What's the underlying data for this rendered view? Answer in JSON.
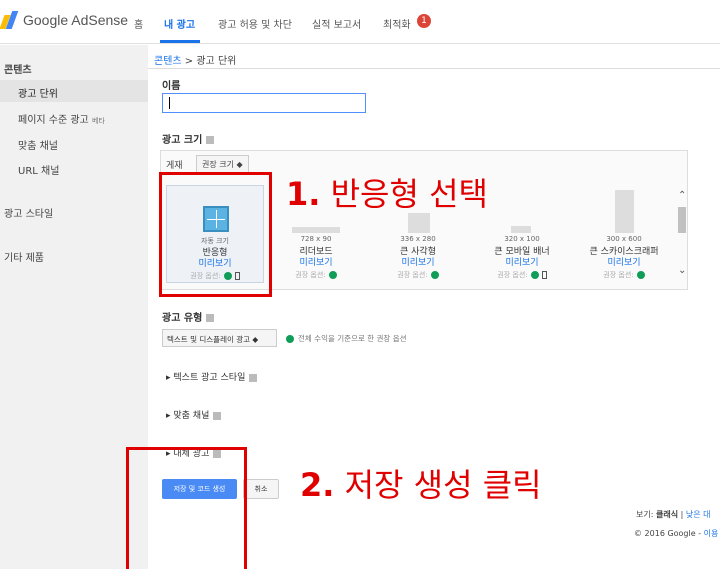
{
  "app": {
    "name": "Google AdSense"
  },
  "nav": [
    {
      "label": "홈"
    },
    {
      "label": "내 광고"
    },
    {
      "label": "광고 허용 및 차단"
    },
    {
      "label": "실적 보고서"
    },
    {
      "label": "최적화"
    }
  ],
  "nav_badge": "1",
  "sidebar": {
    "content_header": "콘텐츠",
    "items": [
      {
        "label": "광고 단위"
      },
      {
        "label": "페이지 수준 광고",
        "badge": "베타"
      },
      {
        "label": "맞춤 채널"
      },
      {
        "label": "URL 채널"
      }
    ],
    "ad_style": "광고 스타일",
    "other_products": "기타 제품"
  },
  "breadcrumb": {
    "link": "콘텐츠",
    "sep": " > ",
    "current": "광고 단위"
  },
  "form": {
    "name_label": "이름",
    "name_value": "",
    "size_label": "광고 크기",
    "filter_label": "게재",
    "filter_select": "권장 크기 ◆",
    "sizes": [
      {
        "dim": "자동 크기",
        "name": "반응형",
        "preview": "미리보기",
        "opt": "권장 옵션:"
      },
      {
        "dim": "728 x 90",
        "name": "리더보드",
        "preview": "미리보기",
        "opt": "권장 옵션:"
      },
      {
        "dim": "336 x 280",
        "name": "큰 사각형",
        "preview": "미리보기",
        "opt": "권장 옵션:"
      },
      {
        "dim": "320 x 100",
        "name": "큰 모바일 배너",
        "preview": "미리보기",
        "opt": "권장 옵션:"
      },
      {
        "dim": "300 x 600",
        "name": "큰 스카이스크래퍼",
        "preview": "미리보기",
        "opt": "권장 옵션:"
      }
    ],
    "type_label": "광고 유형",
    "type_select": "텍스트 및 디스플레이 광고 ◆",
    "type_note": "전체 수익을 기준으로 한 권장 옵션",
    "text_style": "텍스트 광고 스타일",
    "custom_channel": "맞춤 채널",
    "backup_ad": "대체 광고",
    "save_button": "저장 및 코드 생성",
    "cancel_button": "취소"
  },
  "footer": {
    "line1_prefix": "보기: ",
    "line1_bold": "클래식",
    "line1_sep": " | ",
    "line1_link": "낮은 대",
    "line2": "© 2016 Google - ",
    "line2_link": "이용"
  },
  "annotations": {
    "step1_num": "1.",
    "step1_text": "반응형 선택",
    "step2_num": "2.",
    "step2_text": "저장 생성 클릭"
  },
  "colors": {
    "accent": "#1a73e8",
    "annotation": "#e00000",
    "check": "#0f9d58"
  }
}
